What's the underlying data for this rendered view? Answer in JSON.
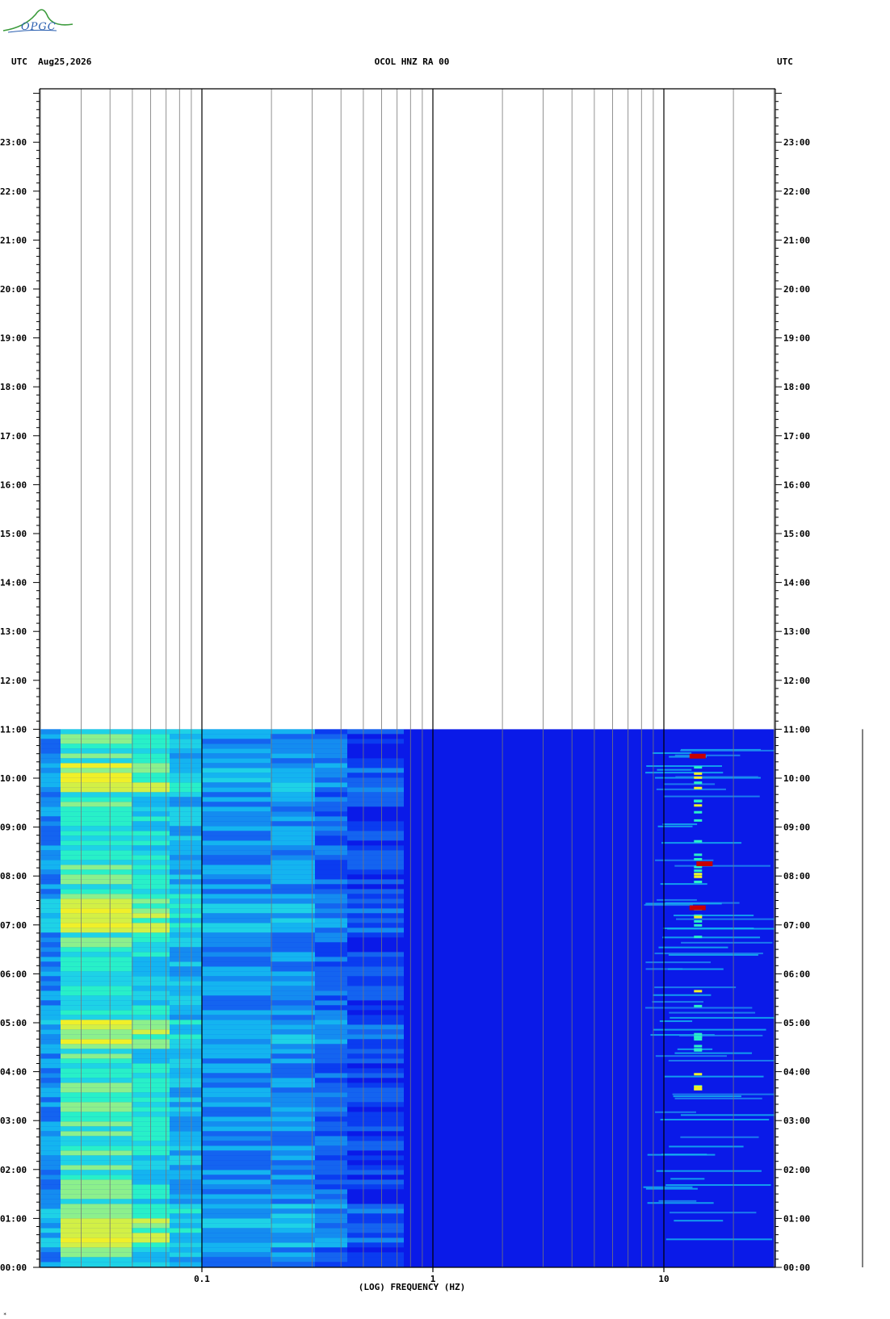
{
  "logo": {
    "text": "OPGC",
    "icon": "opgc-wave-logo"
  },
  "header": {
    "left_label": "UTC",
    "date": "Aug25,2026",
    "station": "OCOL HNZ RA 00",
    "right_label": "UTC"
  },
  "footnote": "*",
  "colors": {
    "background_noise": "#0a1ae8",
    "low_energy": "#0a3cf0",
    "mid_energy": "#14b4f0",
    "high_energy": "#28f0c8",
    "peak": "#f0f028",
    "event": "#c80000"
  },
  "chart_data": {
    "type": "heatmap",
    "title": "OCOL HNZ RA 00",
    "date": "Aug25,2026",
    "xlabel": "(LOG) FREQUENCY (HZ)",
    "ylabel": "UTC",
    "x_scale": "log",
    "x_range_hz": [
      0.02,
      30
    ],
    "x_ticks": [
      {
        "value": 0.1,
        "label": "0.1"
      },
      {
        "value": 1,
        "label": "1"
      },
      {
        "value": 10,
        "label": "10"
      }
    ],
    "y_range_hours": [
      0,
      24
    ],
    "y_ticks": [
      "00:00",
      "01:00",
      "02:00",
      "03:00",
      "04:00",
      "05:00",
      "06:00",
      "07:00",
      "08:00",
      "09:00",
      "10:00",
      "11:00",
      "12:00",
      "13:00",
      "14:00",
      "15:00",
      "16:00",
      "17:00",
      "18:00",
      "19:00",
      "20:00",
      "21:00",
      "22:00",
      "23:00"
    ],
    "data_coverage_hours": [
      0,
      11
    ],
    "grid": true,
    "description_bands": [
      {
        "freq_range_hz": [
          0.02,
          0.1
        ],
        "level": "high",
        "note": "microseism band, cyan-yellow"
      },
      {
        "freq_range_hz": [
          0.1,
          0.3
        ],
        "level": "medium"
      },
      {
        "freq_range_hz": [
          0.3,
          10
        ],
        "level": "low"
      },
      {
        "freq_range_hz": [
          10,
          30
        ],
        "level": "bursts",
        "note": "repeated horizontal streaks, peaks near 14 Hz"
      }
    ],
    "events": [
      {
        "time_hours": 7.35,
        "freq_hz": 14
      },
      {
        "time_hours": 8.25,
        "freq_hz": 15
      },
      {
        "time_hours": 10.45,
        "freq_hz": 14
      }
    ]
  }
}
